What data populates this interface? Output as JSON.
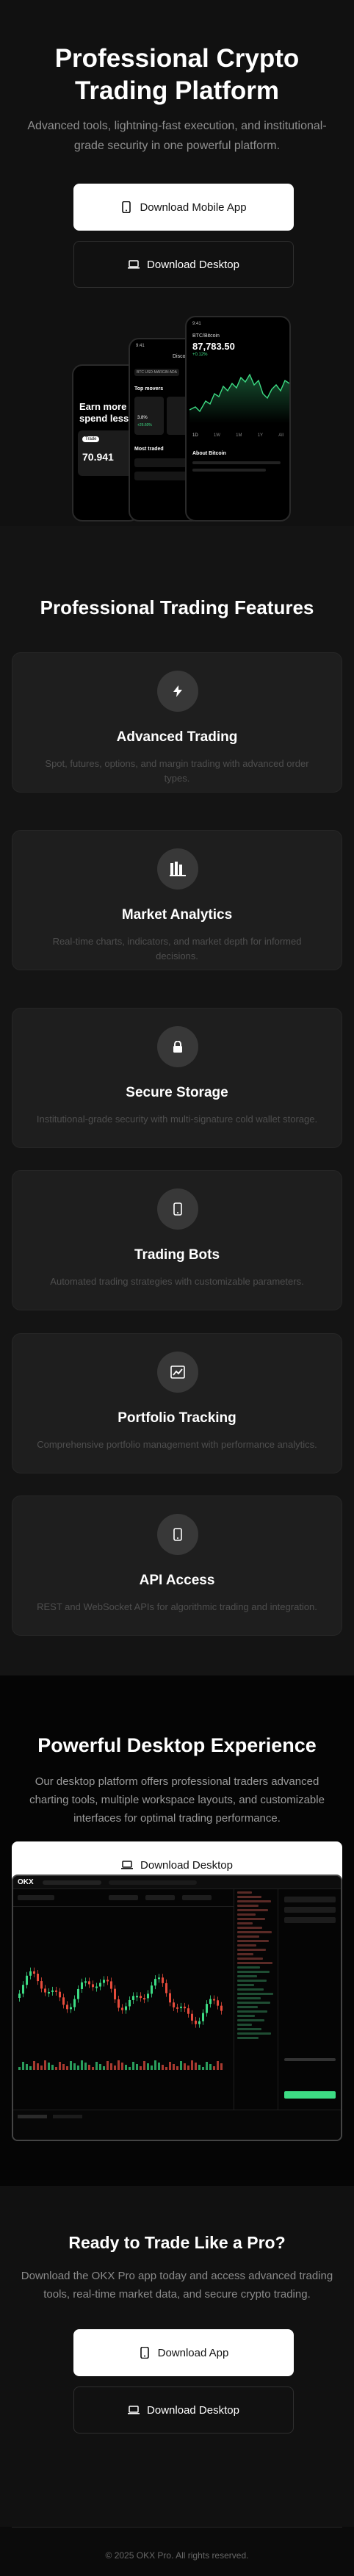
{
  "hero": {
    "title_line1": "Professional Crypto",
    "title_line2": "Trading Platform",
    "subtitle_line1": "Advanced tools, lightning-fast execution, and institutional-",
    "subtitle_line2": "grade security in one powerful platform.",
    "btn_mobile": "Download Mobile App",
    "btn_desktop": "Download Desktop"
  },
  "phones": {
    "left": {
      "headline1": "Earn more a",
      "headline2": "spend less",
      "pill": "Trade",
      "value": "70.941"
    },
    "middle": {
      "time": "9:41",
      "tab": "Discover",
      "row": "BTC  USD-MARGIN  ADA",
      "section": "Top movers",
      "pct1": "3.8%",
      "pct2": "+26.60%",
      "section2": "Most traded"
    },
    "right": {
      "time": "9:41",
      "pair": "BTC/Bitcoin",
      "price": "87,783.50",
      "change": "+0.12%",
      "tabs": [
        "1D",
        "1W",
        "1M",
        "1Y",
        "All"
      ],
      "about": "About Bitcoin"
    }
  },
  "features": {
    "title": "Professional Trading Features",
    "items": [
      {
        "icon": "bolt-icon",
        "title": "Advanced Trading",
        "desc1": "Spot, futures, options, and margin trading with advanced order",
        "desc2": "types."
      },
      {
        "icon": "bar-chart-icon",
        "title": "Market Analytics",
        "desc1": "Real-time charts, indicators, and market depth for informed",
        "desc2": "decisions."
      },
      {
        "icon": "lock-icon",
        "title": "Secure Storage",
        "desc1": "Institutional-grade security with multi-signature cold wallet storage.",
        "desc2": ""
      },
      {
        "icon": "mobile-icon",
        "title": "Trading Bots",
        "desc1": "Automated trading strategies with customizable parameters.",
        "desc2": ""
      },
      {
        "icon": "line-chart-icon",
        "title": "Portfolio Tracking",
        "desc1": "Comprehensive portfolio management with performance analytics.",
        "desc2": ""
      },
      {
        "icon": "mobile-icon",
        "title": "API Access",
        "desc1": "REST and WebSocket APIs for algorithmic trading and integration.",
        "desc2": ""
      }
    ]
  },
  "desktop": {
    "title": "Powerful Desktop Experience",
    "desc1": "Our desktop platform offers professional traders advanced",
    "desc2": "charting tools, multiple workspace layouts, and customizable",
    "desc3": "interfaces for optimal trading performance.",
    "btn": "Download Desktop",
    "mock_logo": "OKX"
  },
  "cta": {
    "title": "Ready to Trade Like a Pro?",
    "desc1": "Download the OKX Pro app today and access advanced trading",
    "desc2": "tools, real-time market data, and secure crypto trading.",
    "btn_app": "Download App",
    "btn_desktop": "Download Desktop"
  },
  "footer": {
    "copyright": "© 2025 OKX Pro. All rights reserved."
  },
  "colors": {
    "bg": "#0b0b0b",
    "card": "#1e1e1e",
    "accent_green": "#3ddc84",
    "accent_red": "#e74c3c"
  }
}
